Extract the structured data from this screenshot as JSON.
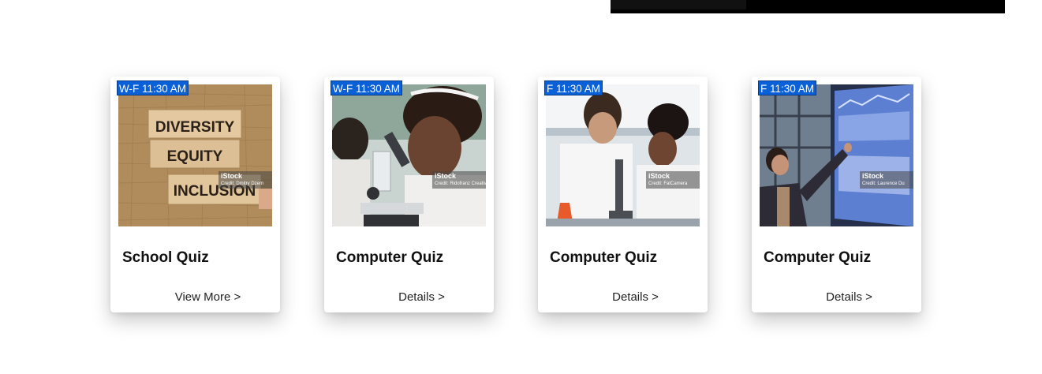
{
  "cards": [
    {
      "schedule": "W-F 11:30 AM",
      "title": "School Quiz",
      "action": "View More >",
      "image": {
        "blocks": [
          "DIVERSITY",
          "EQUITY",
          "INCLUSION"
        ],
        "watermark_brand": "iStock",
        "watermark_credit": "Credit: Dmitry Dzem"
      }
    },
    {
      "schedule": "W-F 11:30 AM",
      "title": "Computer Quiz",
      "action": "Details >",
      "image": {
        "watermark_brand": "iStock",
        "watermark_credit": "Credit: Ridofranz Creative Re"
      }
    },
    {
      "schedule": "F 11:30 AM",
      "title": "Computer Quiz",
      "action": "Details >",
      "image": {
        "watermark_brand": "iStock",
        "watermark_credit": "Credit: FatCamera"
      }
    },
    {
      "schedule": "F 11:30 AM",
      "title": "Computer Quiz",
      "action": "Details >",
      "image": {
        "watermark_brand": "iStock",
        "watermark_credit": "Credit: Laurence Du"
      }
    }
  ],
  "colors": {
    "badge": "#0a60d6",
    "topbar": "#000000"
  }
}
